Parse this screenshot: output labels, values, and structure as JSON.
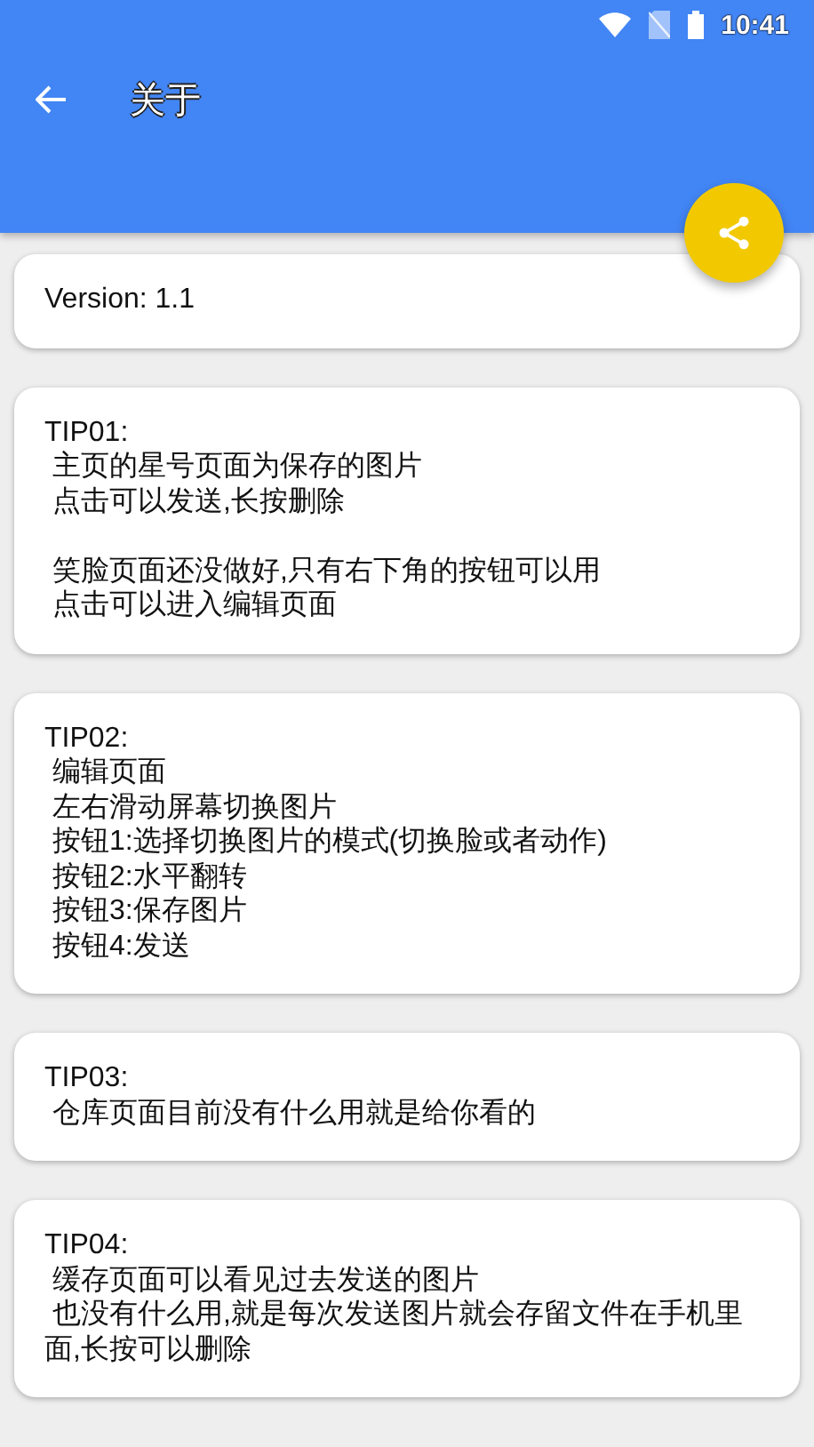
{
  "status_bar": {
    "time": "10:41"
  },
  "app_bar": {
    "title": "关于"
  },
  "cards": [
    {
      "paragraphs": [
        {
          "lines": [
            "Version: 1.1"
          ]
        }
      ]
    },
    {
      "paragraphs": [
        {
          "lines": [
            "TIP01:",
            " 主页的星号页面为保存的图片",
            " 点击可以发送,长按删除"
          ]
        },
        {
          "lines": [
            " 笑脸页面还没做好,只有右下角的按钮可以用",
            " 点击可以进入编辑页面"
          ]
        }
      ]
    },
    {
      "paragraphs": [
        {
          "lines": [
            "TIP02:",
            " 编辑页面",
            " 左右滑动屏幕切换图片",
            " 按钮1:选择切换图片的模式(切换脸或者动作)",
            " 按钮2:水平翻转",
            " 按钮3:保存图片",
            " 按钮4:发送"
          ]
        }
      ]
    },
    {
      "paragraphs": [
        {
          "lines": [
            "TIP03:",
            " 仓库页面目前没有什么用就是给你看的"
          ]
        }
      ]
    },
    {
      "paragraphs": [
        {
          "lines": [
            "TIP04:",
            " 缓存页面可以看见过去发送的图片",
            " 也没有什么用,就是每次发送图片就会存留文件在手机里面,长按可以删除"
          ]
        }
      ]
    }
  ]
}
